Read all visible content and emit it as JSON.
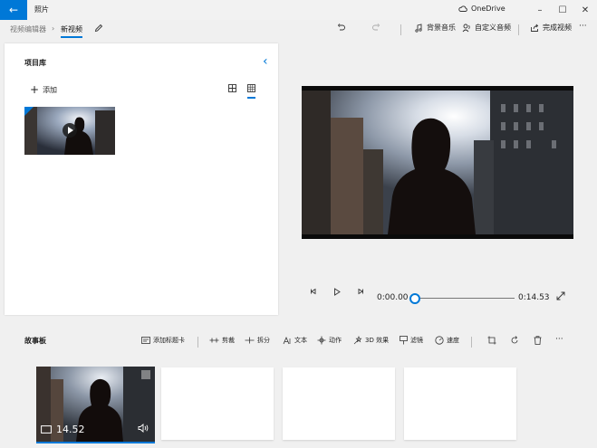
{
  "titlebar": {
    "back_icon": "back-arrow-icon",
    "app_name": "照片",
    "onedrive_label": "OneDrive",
    "minimize": "–",
    "maximize": "☐",
    "close": "✕"
  },
  "breadcrumb": {
    "parent": "视频编辑器",
    "separator": "›",
    "current": "新视频"
  },
  "toolbar": {
    "music_label": "背景音乐",
    "custom_audio_label": "自定义音频",
    "finish_label": "完成视频",
    "more": "···"
  },
  "library": {
    "title": "项目库",
    "add_label": "添加",
    "collapse": "‹"
  },
  "player": {
    "time_current": "0:00.00",
    "time_total": "0:14.53",
    "progress": 0
  },
  "storyboard": {
    "title": "故事板",
    "tools": [
      {
        "label": "添加标题卡"
      },
      {
        "label": "剪裁"
      },
      {
        "label": "拆分"
      },
      {
        "label": "文本"
      },
      {
        "label": "动作"
      },
      {
        "label": "3D 效果"
      },
      {
        "label": "滤镜"
      },
      {
        "label": "速度"
      }
    ],
    "more": "···",
    "clip": {
      "duration": "14.52"
    }
  },
  "colors": {
    "accent": "#0078d7",
    "panel": "#ffffff",
    "background": "#f0f0f0"
  }
}
